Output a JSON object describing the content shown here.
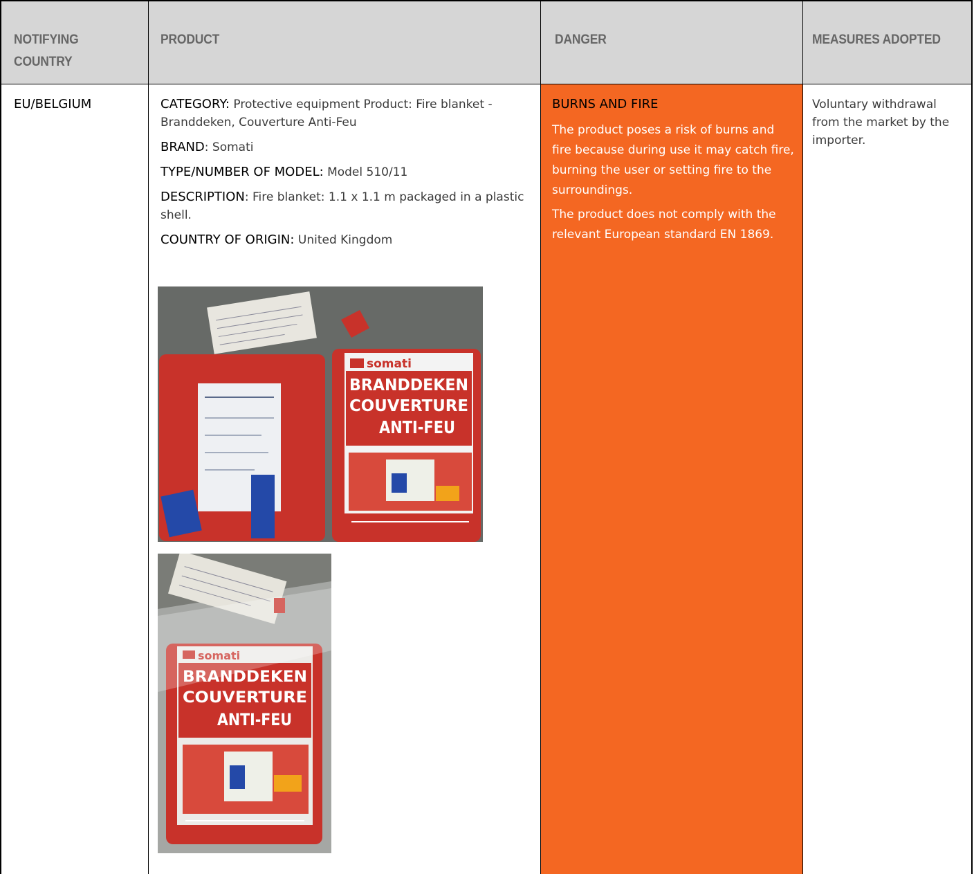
{
  "header": {
    "col_country": "NOTIFYING COUNTRY",
    "col_product": "PRODUCT",
    "col_danger": "DANGER",
    "col_measures": "MEASURES ADOPTED"
  },
  "row": {
    "country": "EU/BELGIUM",
    "product": {
      "category_label": "CATEGORY:",
      "category_value": " Protective equipment Product: Fire blanket - Branddeken, Couverture Anti-Feu",
      "brand_label": "BRAND",
      "brand_value": ": Somati",
      "type_label": "TYPE/NUMBER OF MODEL:",
      "type_value": " Model 510/11",
      "description_label": "DESCRIPTION",
      "description_value": ": Fire blanket: 1.1 x 1.1 m packaged in a plastic shell.",
      "origin_label": "COUNTRY OF ORIGIN:",
      "origin_value": " United Kingdom"
    },
    "photo1": {
      "brand": "somati",
      "line1": "BRANDDEKEN",
      "line2": "COUVERTURE",
      "line3": "ANTI-FEU"
    },
    "photo2": {
      "brand": "somati",
      "line1": "BRANDDEKEN",
      "line2": "COUVERTURE",
      "line3": "ANTI-FEU"
    },
    "danger": {
      "title": "BURNS AND FIRE",
      "para1": "The product poses a risk of burns and fire because during use it may catch fire, burning the user or setting fire to the surroundings.",
      "para2": "The product does not comply with the relevant European standard EN 1869."
    },
    "measures": "Voluntary withdrawal from the market by the importer."
  },
  "colors": {
    "header_bg": "#d6d6d6",
    "header_text": "#666666",
    "danger_bg": "#f46722",
    "blanket_red": "#c8322a"
  }
}
